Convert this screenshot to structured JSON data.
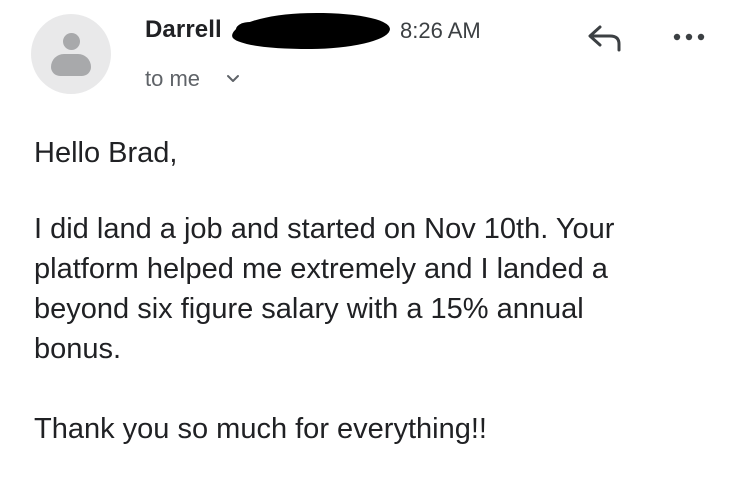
{
  "header": {
    "sender_name": "Darrell",
    "time": "8:26 AM",
    "recipient": "to me",
    "icons": {
      "avatar": "person-avatar-icon",
      "reply": "reply-arrow-icon",
      "more": "more-options-dots-icon",
      "expand": "chevron-down-icon"
    }
  },
  "message": {
    "greeting": "Hello Brad,",
    "paragraph1_lines": [
      "I did land a job and started on Nov 10th. Your",
      "platform helped me extremely and I landed a",
      "beyond six figure salary with a 15% annual",
      "bonus."
    ],
    "closing": "Thank you so much for everything!!"
  },
  "colors": {
    "text_primary": "#202124",
    "text_secondary": "#5f6368",
    "avatar_bg": "#e9e9ea",
    "avatar_fg": "#a8a9ab",
    "redaction": "#000000"
  }
}
